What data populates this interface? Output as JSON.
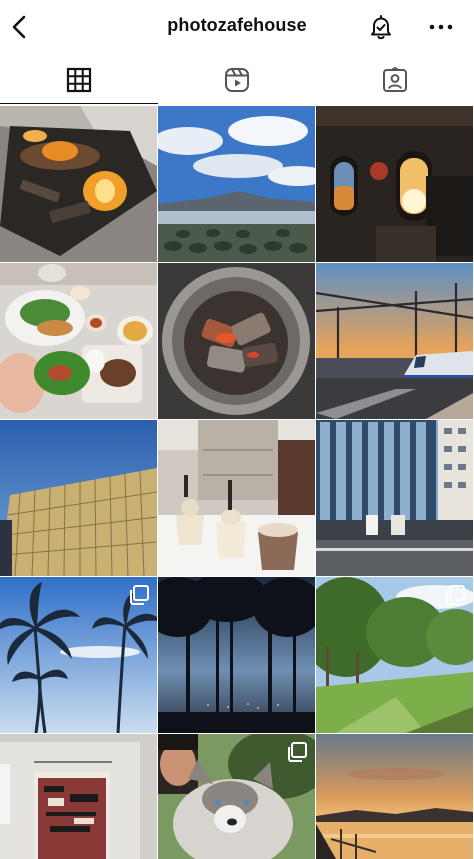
{
  "header": {
    "username": "photozafehouse",
    "back_icon": "chevron-left-icon",
    "notification_icon": "bell-check-icon",
    "more_icon": "more-horizontal-icon"
  },
  "tabs": [
    {
      "name": "posts",
      "icon": "grid-icon",
      "active": true
    },
    {
      "name": "reels",
      "icon": "reels-icon",
      "active": false
    },
    {
      "name": "tagged",
      "icon": "tagged-person-icon",
      "active": false
    }
  ],
  "grid": {
    "posts": [
      {
        "subject": "fireplace",
        "multi": false
      },
      {
        "subject": "mountain-lake",
        "multi": false
      },
      {
        "subject": "airplane-window-sunset",
        "multi": false
      },
      {
        "subject": "korean-food",
        "multi": false
      },
      {
        "subject": "charcoal-grill",
        "multi": false
      },
      {
        "subject": "train-sunset",
        "multi": false
      },
      {
        "subject": "dior-building",
        "multi": false
      },
      {
        "subject": "ice-cream-cups",
        "multi": false
      },
      {
        "subject": "office-building",
        "multi": false
      },
      {
        "subject": "palm-trees",
        "multi": true
      },
      {
        "subject": "tree-silhouettes",
        "multi": false
      },
      {
        "subject": "green-park",
        "multi": true
      },
      {
        "subject": "wall-poster",
        "multi": false
      },
      {
        "subject": "husky-dog",
        "multi": true
      },
      {
        "subject": "river-sunset",
        "multi": false
      }
    ]
  },
  "colors": {
    "text": "#111111",
    "background": "#ffffff"
  }
}
